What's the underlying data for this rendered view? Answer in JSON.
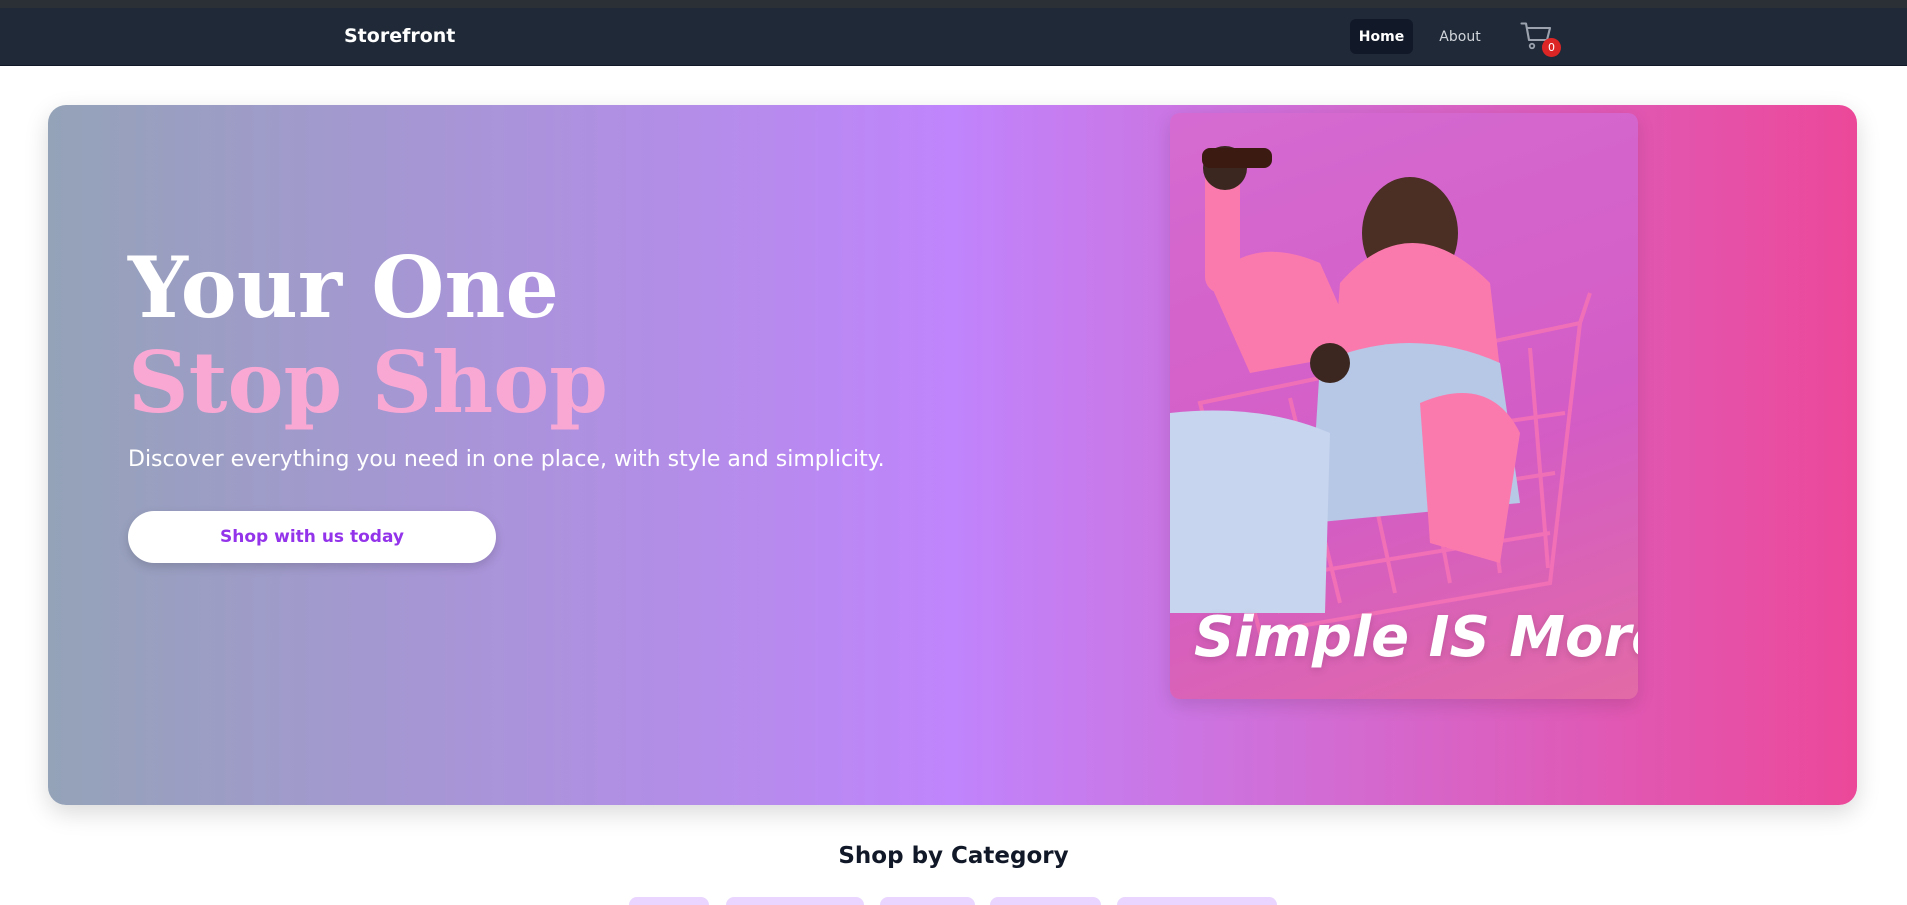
{
  "app": {
    "brand": "Storefront",
    "nav": {
      "home": "Home",
      "about": "About"
    },
    "cart_count": "0",
    "colors": {
      "navbar": "#1f2937",
      "accent": "#9333ea",
      "badge": "#dc2626"
    }
  },
  "hero": {
    "headline_line1": "Your One",
    "headline_line2": "Stop Shop",
    "subtitle": "Discover everything you need in one place, with style and simplicity.",
    "cta_label": "Shop with us today",
    "promo_text": "Simple IS More",
    "gradient": [
      "#94a3b8",
      "#c084fc",
      "#ec4899"
    ]
  },
  "section": {
    "title": "Shop by Category"
  }
}
